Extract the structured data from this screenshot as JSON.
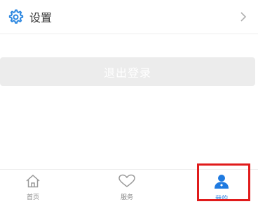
{
  "settings": {
    "label": "设置",
    "icon": "gear-icon",
    "chevron": "chevron-right-icon"
  },
  "logout": {
    "label": "退出登录"
  },
  "tabbar": {
    "items": [
      {
        "label": "首页",
        "icon": "home-icon"
      },
      {
        "label": "服务",
        "icon": "heart-icon"
      },
      {
        "label": "我的",
        "icon": "user-icon"
      }
    ],
    "active_color": "#1f7ae0"
  },
  "highlight_color": "#e01b1b"
}
